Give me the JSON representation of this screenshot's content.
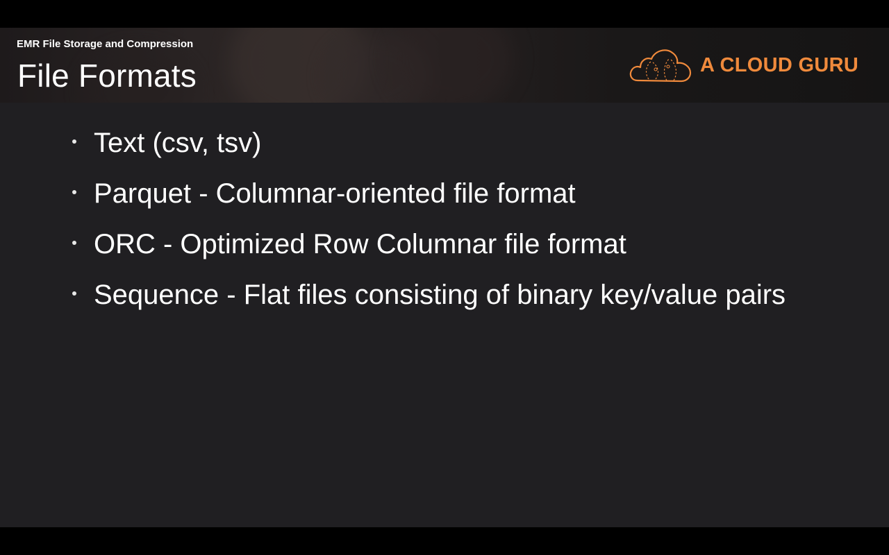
{
  "header": {
    "section_label": "EMR File Storage and Compression",
    "title": "File Formats"
  },
  "logo": {
    "text": "A CLOUD GURU",
    "icon": "cloud-icon",
    "color": "#f08a3c"
  },
  "bullets": [
    {
      "text": "Text (csv, tsv)"
    },
    {
      "text": "Parquet - Columnar-oriented file format"
    },
    {
      "text": "ORC - Optimized Row Columnar file format"
    },
    {
      "text": "Sequence - Flat files consisting of binary key/value pairs"
    }
  ],
  "colors": {
    "background": "#201f22",
    "text": "#ffffff",
    "accent": "#f08a3c"
  }
}
